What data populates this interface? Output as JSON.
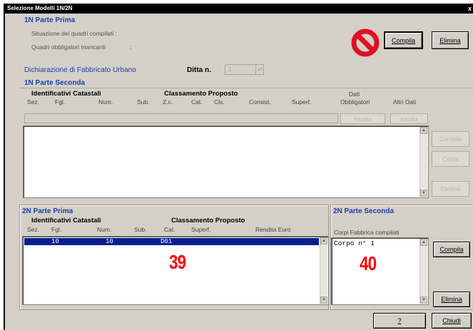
{
  "window": {
    "title": "Selezione Modelli 1N/2N",
    "close_glyph": "x"
  },
  "parte_prima_1n": {
    "title": "1N Parte Prima",
    "situazione_label": "Situazione dei quadri compilati :",
    "obbligatori_label": "Quadri obbligatori mancanti",
    "obbligatori_colon": ":",
    "prohibited_icon": "no-entry-icon",
    "compila_label": "Compila",
    "elimina_label": "Elimina"
  },
  "dichiarazione": {
    "label": "Dichiarazione di Fabbricato Urbano",
    "ditta_label": "Ditta n.",
    "ditta_value": "1"
  },
  "parte_seconda_1n": {
    "title": "1N Parte Seconda",
    "identificativi": "Identificativi Catastali",
    "classamento": "Classamento Proposto",
    "dati_obbligatori_1": "Dati",
    "dati_obbligatori_2": "Obbligatori",
    "altri_dati": "Altri Dati",
    "columns": [
      "Sez.",
      "Fgl.",
      "Num.",
      "Sub.",
      "Z.c.",
      "Cat.",
      "Cls.",
      "Consist.",
      "Superf."
    ],
    "incolla_1": "Incolla",
    "incolla_2": "Incolla",
    "compila_label": "Compila",
    "copia_label": "Copia",
    "elimina_label": "Elimina"
  },
  "parte_prima_2n": {
    "title": "2N Parte Prima",
    "identificativi": "Identificativi Catastali",
    "classamento": "Classamento Proposto",
    "columns": [
      "Sez.",
      "Fgl.",
      "Num.",
      "Sub.",
      "Cat.",
      "Superf.",
      "Rendita Euro"
    ],
    "rows": [
      {
        "fgl": "10",
        "num": "10",
        "cat": "D01"
      }
    ],
    "annotation": "39"
  },
  "parte_seconda_2n": {
    "title": "2N Parte Seconda",
    "corpi_label": "Corpi Fabbrica compilati",
    "corpo_item": "Corpo n°    1",
    "annotation": "40",
    "compila_label": "Compila",
    "elimina_label": "Elimina"
  },
  "footer": {
    "help_label": "?",
    "chiudi_label": "Chiudi"
  },
  "colors": {
    "title_bg": "#000000",
    "group_title": "#1e3fa8",
    "selection": "#0a1f8f",
    "annotation": "#ff0000",
    "prohibited": "#e01020"
  }
}
